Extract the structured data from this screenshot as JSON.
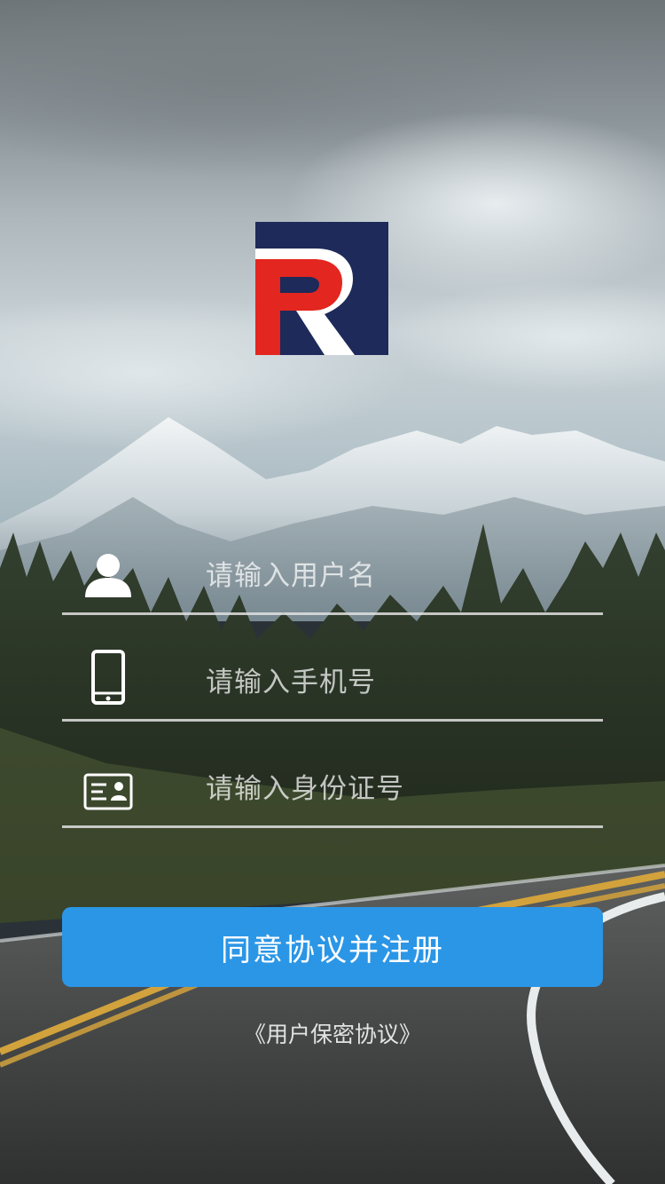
{
  "logo": {
    "letter": "R",
    "colors": {
      "red": "#e3261f",
      "navy": "#1d2a5a",
      "white": "#ffffff"
    }
  },
  "form": {
    "username": {
      "icon": "user-icon",
      "placeholder": "请输入用户名",
      "value": ""
    },
    "phone": {
      "icon": "phone-icon",
      "placeholder": "请输入手机号",
      "value": ""
    },
    "id_card": {
      "icon": "id-card-icon",
      "placeholder": "请输入身份证号",
      "value": ""
    }
  },
  "submit_label": "同意协议并注册",
  "agreement_link": "《用户保密协议》",
  "colors": {
    "accent": "#2b96e6"
  }
}
